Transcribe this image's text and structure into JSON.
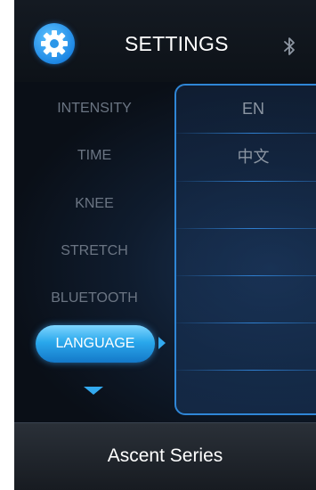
{
  "header": {
    "title": "SETTINGS",
    "settings_icon": "gear-icon",
    "status_icon": "bluetooth-icon"
  },
  "menu": {
    "items": [
      {
        "label": "INTENSITY"
      },
      {
        "label": "TIME"
      },
      {
        "label": "KNEE"
      },
      {
        "label": "STRETCH"
      },
      {
        "label": "BLUETOOTH"
      },
      {
        "label": "LANGUAGE",
        "selected": true
      }
    ],
    "more_indicator": "chevron-down-icon"
  },
  "language_panel": {
    "options": [
      {
        "label": "EN"
      },
      {
        "label": "中文"
      },
      {
        "label": ""
      },
      {
        "label": ""
      },
      {
        "label": ""
      },
      {
        "label": ""
      },
      {
        "label": ""
      }
    ]
  },
  "footer": {
    "model_name": "Ascent Series"
  },
  "colors": {
    "accent": "#2aa8ec",
    "panel_border": "#2f86d6",
    "background": "#0a0d12",
    "inactive_text": "#6b7583"
  }
}
